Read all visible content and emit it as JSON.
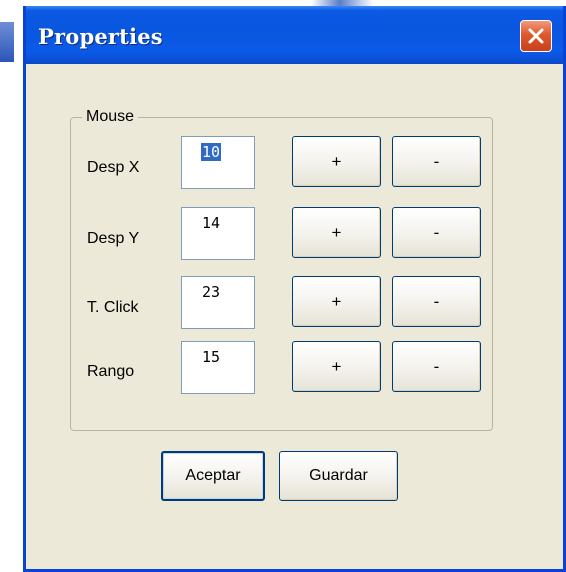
{
  "window": {
    "title": "Properties",
    "close_icon": "close-icon"
  },
  "group": {
    "legend": "Mouse",
    "rows": [
      {
        "label": "Desp X",
        "value": "10",
        "plus": "+",
        "minus": "-"
      },
      {
        "label": "Desp Y",
        "value": "14",
        "plus": "+",
        "minus": "-"
      },
      {
        "label": "T. Click",
        "value": "23",
        "plus": "+",
        "minus": "-"
      },
      {
        "label": "Rango",
        "value": "15",
        "plus": "+",
        "minus": "-"
      }
    ]
  },
  "footer": {
    "accept_label": "Aceptar",
    "save_label": "Guardar"
  },
  "colors": {
    "titlebar": "#0b5ae3",
    "close": "#e0582f",
    "dialog_bg": "#ece9d8",
    "selection": "#316ac5"
  }
}
